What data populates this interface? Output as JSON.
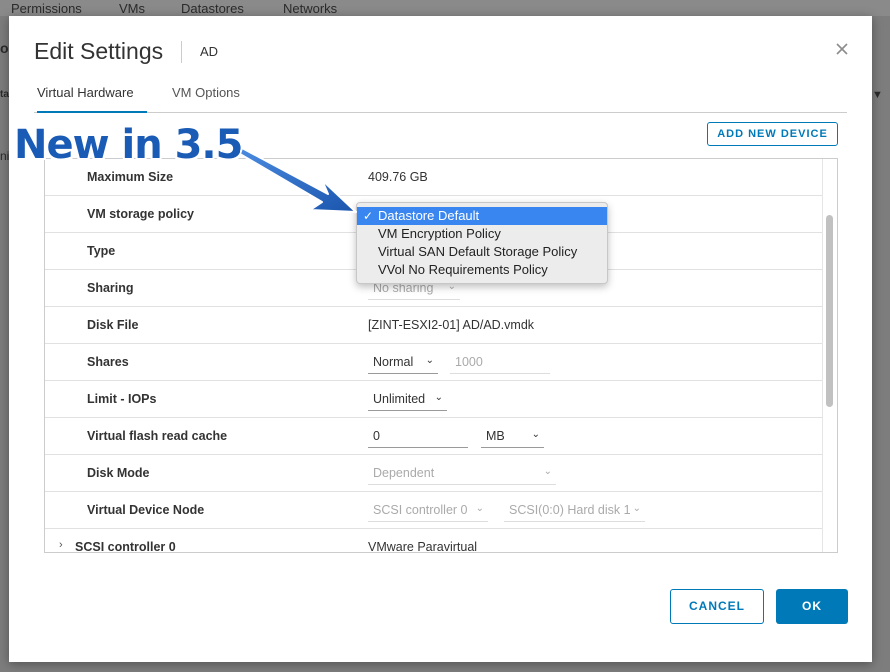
{
  "background": {
    "tabs": [
      "Permissions",
      "VMs",
      "Datastores",
      "Networks"
    ],
    "side_fragments": [
      "o",
      "ta",
      "ni"
    ],
    "right_chevron": "▼"
  },
  "dialog": {
    "title": "Edit Settings",
    "subtitle": "AD",
    "tabs": [
      "Virtual Hardware",
      "VM Options"
    ],
    "add_device_label": "ADD NEW DEVICE",
    "cancel_label": "CANCEL",
    "ok_label": "OK"
  },
  "hardware": {
    "maximum_size": {
      "label": "Maximum Size",
      "value": "409.76 GB"
    },
    "storage_policy": {
      "label": "VM storage policy"
    },
    "type": {
      "label": "Type"
    },
    "sharing": {
      "label": "Sharing",
      "value": "No sharing"
    },
    "disk_file": {
      "label": "Disk File",
      "value": "[ZINT-ESXI2-01] AD/AD.vmdk"
    },
    "shares": {
      "label": "Shares",
      "value": "Normal",
      "number": "1000"
    },
    "limit_iops": {
      "label": "Limit - IOPs",
      "value": "Unlimited"
    },
    "flash_cache": {
      "label": "Virtual flash read cache",
      "value": "0",
      "unit": "MB"
    },
    "disk_mode": {
      "label": "Disk Mode",
      "value": "Dependent"
    },
    "device_node": {
      "label": "Virtual Device Node",
      "controller": "SCSI controller 0",
      "disk": "SCSI(0:0) Hard disk 1"
    },
    "scsi_controller": {
      "label": "SCSI controller 0",
      "value": "VMware Paravirtual"
    }
  },
  "storage_policy_dropdown": {
    "check": "✓",
    "options": [
      "Datastore Default",
      "VM Encryption Policy",
      "Virtual SAN Default Storage Policy",
      "VVol No Requirements Policy"
    ],
    "selected": "Datastore Default"
  },
  "annotation": {
    "text": "New in 3.5"
  },
  "icons": {
    "close": "close-icon",
    "chevron": "chevron-down-icon",
    "expand": "chevron-right-icon"
  },
  "colors": {
    "accent": "#0079b8",
    "annotation": "#1a5bb5",
    "dropdown_highlight": "#3a86f0"
  }
}
